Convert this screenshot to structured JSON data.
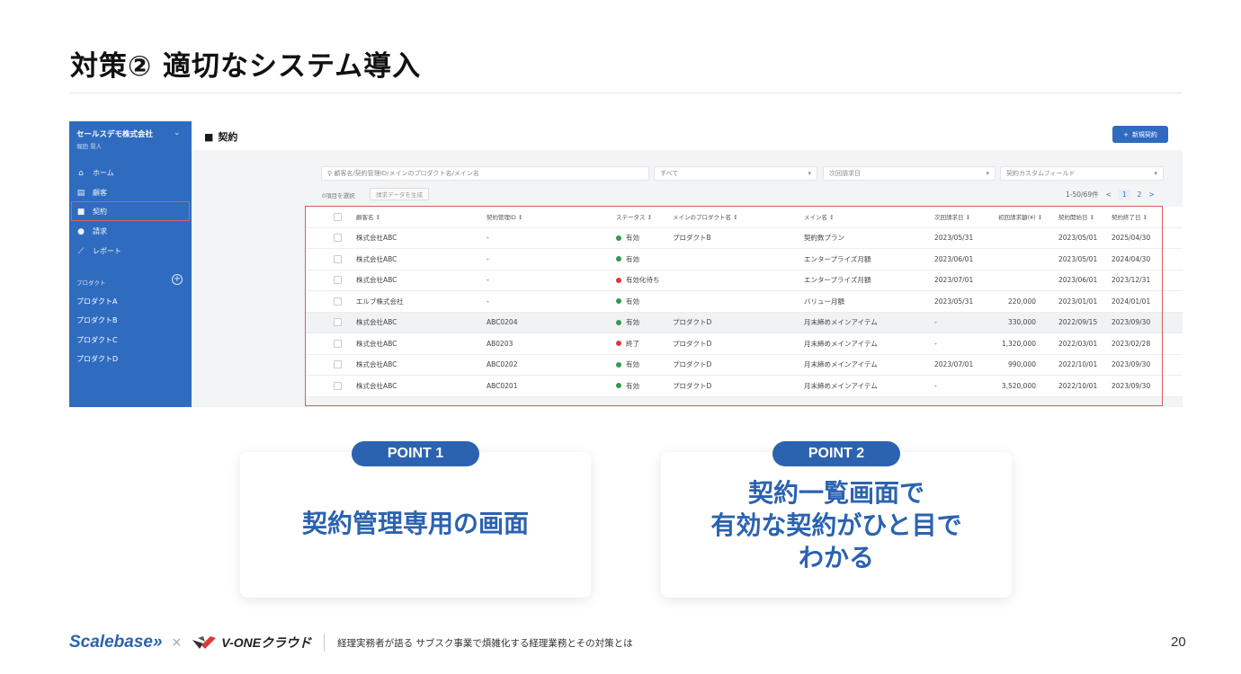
{
  "slide": {
    "title": "対策② 適切なシステム導入",
    "page_number": "20"
  },
  "app": {
    "sidebar": {
      "company": "セールスデモ株式会社",
      "user": "堀田 晃人",
      "nav": [
        {
          "label": "ホーム",
          "icon": "home-icon"
        },
        {
          "label": "顧客",
          "icon": "building-icon"
        },
        {
          "label": "契約",
          "icon": "bookmark-icon"
        },
        {
          "label": "請求",
          "icon": "yen-coin-icon"
        },
        {
          "label": "レポート",
          "icon": "chart-line-icon"
        }
      ],
      "products_heading": "プロダクト",
      "products": [
        "プロダクトA",
        "プロダクトB",
        "プロダクトC",
        "プロダクトD"
      ]
    },
    "header": {
      "page_title": "契約",
      "new_button": "新規契約"
    },
    "filters": {
      "search_placeholder": "顧客名/契約管理ID/メインのプロダクト名/メイン名",
      "status_select": "すべて",
      "next_billing_placeholder": "次回請求日",
      "custom_field_placeholder": "契約カスタムフィールド"
    },
    "toolbar": {
      "selected_count": "0項目を選択",
      "generate_button": "請求データを生成",
      "range": "1-50/69件",
      "prev": "<",
      "page1": "1",
      "page2": "2",
      "next": ">"
    },
    "table": {
      "columns": [
        "顧客名 ↕",
        "契約管理ID ↕",
        "ステータス ↕",
        "メインのプロダクト名 ↕",
        "メイン名 ↕",
        "次回請求日 ↕",
        "初回請求額(¥) ↕",
        "契約開始日 ↕",
        "契約終了日 ↕"
      ],
      "rows": [
        {
          "customer": "株式会社ABC",
          "id": "-",
          "status": "有効",
          "status_color": "#2e9c4a",
          "product": "プロダクトB",
          "plan": "契約数プラン",
          "next": "2023/05/31",
          "amount": "",
          "start": "2023/05/01",
          "end": "2025/04/30",
          "highlight": false
        },
        {
          "customer": "株式会社ABC",
          "id": "-",
          "status": "有効",
          "status_color": "#2e9c4a",
          "product": "",
          "plan": "エンタープライズ月額",
          "next": "2023/06/01",
          "amount": "",
          "start": "2023/05/01",
          "end": "2024/04/30",
          "highlight": false
        },
        {
          "customer": "株式会社ABC",
          "id": "-",
          "status": "有効化待ち",
          "status_color": "#d93a3a",
          "product": "",
          "plan": "エンタープライズ月額",
          "next": "2023/07/01",
          "amount": "",
          "start": "2023/06/01",
          "end": "2023/12/31",
          "highlight": false
        },
        {
          "customer": "エルブ株式会社",
          "id": "-",
          "status": "有効",
          "status_color": "#2e9c4a",
          "product": "",
          "plan": "バリュー月額",
          "next": "2023/05/31",
          "amount": "220,000",
          "start": "2023/01/01",
          "end": "2024/01/01",
          "highlight": false
        },
        {
          "customer": "株式会社ABC",
          "id": "ABC0204",
          "status": "有効",
          "status_color": "#2e9c4a",
          "product": "プロダクトD",
          "plan": "月末締めメインアイテム",
          "next": "-",
          "amount": "330,000",
          "start": "2022/09/15",
          "end": "2023/09/30",
          "highlight": true
        },
        {
          "customer": "株式会社ABC",
          "id": "AB0203",
          "status": "終了",
          "status_color": "#d93a3a",
          "product": "プロダクトD",
          "plan": "月末締めメインアイテム",
          "next": "-",
          "amount": "1,320,000",
          "start": "2022/03/01",
          "end": "2023/02/28",
          "highlight": false
        },
        {
          "customer": "株式会社ABC",
          "id": "ABC0202",
          "status": "有効",
          "status_color": "#2e9c4a",
          "product": "プロダクトD",
          "plan": "月末締めメインアイテム",
          "next": "2023/07/01",
          "amount": "990,000",
          "start": "2022/10/01",
          "end": "2023/09/30",
          "highlight": false
        },
        {
          "customer": "株式会社ABC",
          "id": "ABC0201",
          "status": "有効",
          "status_color": "#2e9c4a",
          "product": "プロダクトD",
          "plan": "月末締めメインアイテム",
          "next": "-",
          "amount": "3,520,000",
          "start": "2022/10/01",
          "end": "2023/09/30",
          "highlight": false
        }
      ]
    }
  },
  "points": [
    {
      "badge": "POINT 1",
      "lines": [
        "契約管理専用の画面"
      ]
    },
    {
      "badge": "POINT 2",
      "lines": [
        "契約一覧画面で",
        "有効な契約がひと目で",
        "わかる"
      ]
    }
  ],
  "footer": {
    "brand1": "Scalebase»",
    "times": "×",
    "brand2": "V-ONEクラウド",
    "text": "経理実務者が語る サブスク事業で煩雑化する経理業務とその対策とは"
  },
  "colors": {
    "accent": "#2b63b0",
    "sidebar": "#2f6cc0",
    "highlight_border": "#e05a5a"
  }
}
